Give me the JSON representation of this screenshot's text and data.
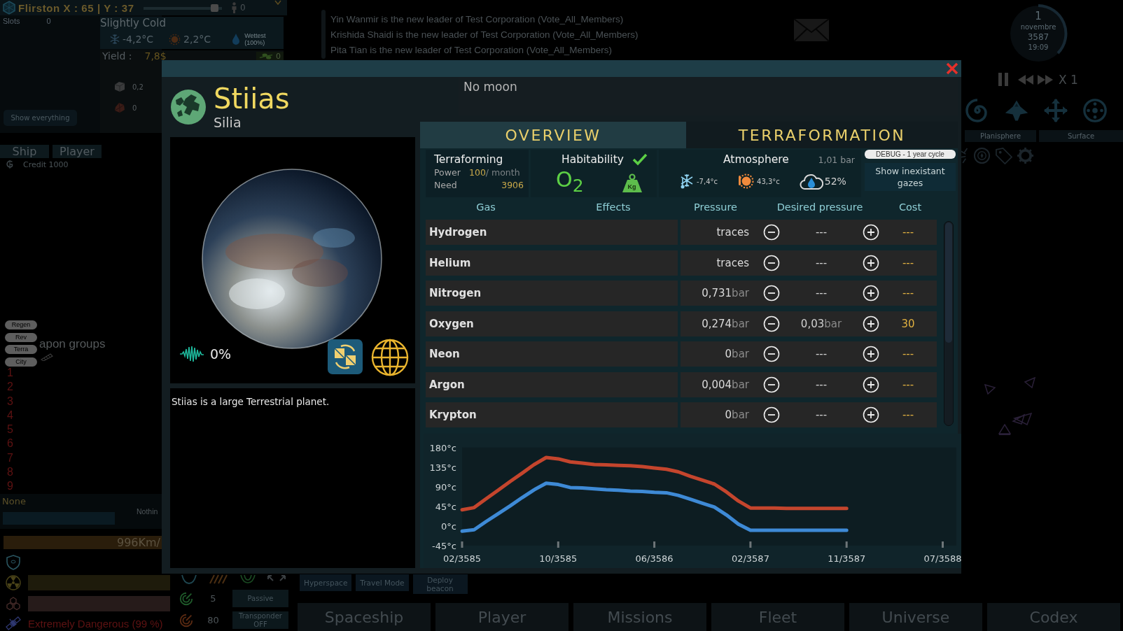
{
  "location_bar": {
    "title": "Flirston X : 65 | Y : 37",
    "slider": {
      "level": 0.95
    },
    "population": "0"
  },
  "slots": {
    "label": "Slots",
    "value": "0"
  },
  "weather": {
    "title": "Slightly Cold",
    "min_temp": "-4,2°C",
    "max_temp": "2,2°C",
    "humidity_label": "Wettest",
    "humidity_value": "(100%)"
  },
  "yield": {
    "label": "Yield :",
    "value": "7,8$",
    "food": "0",
    "resources": [
      {
        "kind": "stone",
        "amount": "0,2"
      },
      {
        "kind": "ore",
        "amount": "0"
      }
    ]
  },
  "show_everything_button": "Show everything",
  "panel_tabs": [
    {
      "label": "Ship",
      "selected": false
    },
    {
      "label": "Player",
      "selected": false
    }
  ],
  "credit": "Credit 1000",
  "module_tags": [
    "Regen",
    "Rev",
    "Terra",
    "City"
  ],
  "weapon_groups": {
    "title": "apon groups",
    "slots": [
      "1",
      "2",
      "3",
      "4",
      "5",
      "6",
      "7",
      "8",
      "9"
    ]
  },
  "target": {
    "name": "None",
    "status": "Nothin"
  },
  "speed": "996Km/",
  "danger": "Extremely Dangerous (99 %)",
  "sensors": [
    {
      "kind": "radar",
      "value": "5",
      "mode": "Passive"
    },
    {
      "kind": "transponder",
      "value": "80",
      "mode": "Transponder OFF"
    }
  ],
  "travel_buttons": [
    "Hyperspace",
    "Travel Mode",
    "Deploy beacon"
  ],
  "messages": [
    "Yin Wanmir is the new leader of Test Corporation (Vote_All_Members)",
    "Krishida Shaidi is the new leader of Test Corporation (Vote_All_Members)",
    "Pita Tian is the new leader of Test Corporation (Vote_All_Members)"
  ],
  "clock": {
    "day": "1",
    "month": "novembre",
    "year": "3587",
    "time": "19:09"
  },
  "time_speed": "X 1",
  "view_tabs": [
    "Planisphere",
    "Surface"
  ],
  "main_tabs": [
    {
      "label": "Spaceship",
      "selected": false
    },
    {
      "label": "Player",
      "selected": false
    },
    {
      "label": "Missions",
      "selected": false
    },
    {
      "label": "Fleet",
      "selected": false
    },
    {
      "label": "Universe",
      "selected": false
    },
    {
      "label": "Codex",
      "selected": false
    }
  ],
  "planet_window": {
    "name": "Stiias",
    "system": "Silia",
    "moon": "No moon",
    "life": "0%",
    "description": "Stiias is a large Terrestrial planet.",
    "tabs": [
      {
        "label": "OVERVIEW",
        "selected": true
      },
      {
        "label": "TERRAFORMATION",
        "selected": false
      }
    ],
    "terraforming": {
      "title": "Terraforming",
      "power_label": "Power",
      "power": "100",
      "power_unit": "/ month",
      "need_label": "Need",
      "need": "3906"
    },
    "habitability": {
      "title": "Habitability",
      "habitable": true,
      "oxygen": "O$_{2}$",
      "gravity": "Kg"
    },
    "atmosphere": {
      "title": "Atmosphere",
      "pressure": "1,01 bar",
      "min_temp": "-7,4°c",
      "max_temp": "43,3°c",
      "humidity": "52%"
    },
    "debug_label": "DEBUG - 1 year cycle",
    "show_gases_button": "Show inexistant gazes",
    "columns": [
      "Gas",
      "Effects",
      "Pressure",
      "Desired pressure",
      "Cost"
    ],
    "gases": [
      {
        "name": "Hydrogen",
        "pressure": "traces",
        "desired": "---",
        "cost": "---"
      },
      {
        "name": "Helium",
        "pressure": "traces",
        "desired": "---",
        "cost": "---"
      },
      {
        "name": "Nitrogen",
        "pressure": "0,731",
        "pressure_unit": "bar",
        "desired": "---",
        "cost": "---"
      },
      {
        "name": "Oxygen",
        "pressure": "0,274",
        "pressure_unit": "bar",
        "desired": "0,03",
        "desired_unit": "bar",
        "cost": "30"
      },
      {
        "name": "Neon",
        "pressure": "0",
        "pressure_unit": "bar",
        "desired": "---",
        "cost": "---"
      },
      {
        "name": "Argon",
        "pressure": "0,004",
        "pressure_unit": "bar",
        "desired": "---",
        "cost": "---"
      },
      {
        "name": "Krypton",
        "pressure": "0",
        "pressure_unit": "bar",
        "desired": "---",
        "cost": "---"
      }
    ],
    "chart_data": {
      "type": "line",
      "categories": [
        "02/3585",
        null,
        null,
        null,
        null,
        null,
        null,
        null,
        "10/3585",
        null,
        null,
        null,
        null,
        null,
        null,
        null,
        "06/3586",
        null,
        null,
        null,
        null,
        null,
        null,
        null,
        "02/3587",
        null,
        null,
        null,
        null,
        null,
        null,
        null,
        "11/3587",
        null,
        null,
        null,
        null,
        null,
        null,
        null,
        "07/3588"
      ],
      "series": [
        {
          "color": "#c4452d",
          "values": [
            37,
            42,
            62,
            82,
            102,
            121,
            141,
            157,
            154,
            147,
            144,
            141,
            140,
            139,
            138,
            136,
            133,
            130,
            124,
            114,
            105,
            96,
            78,
            57,
            41,
            41,
            41,
            40,
            40,
            40,
            40,
            40,
            40,
            null,
            null,
            null,
            null,
            null,
            null,
            null,
            null
          ]
        },
        {
          "color": "#3e8ad6",
          "values": [
            -12,
            -9,
            10,
            28,
            46,
            65,
            83,
            98,
            95,
            88,
            87,
            85,
            83,
            82,
            80,
            79,
            77,
            76,
            70,
            61,
            52,
            43,
            25,
            4,
            -10,
            -10,
            -10,
            -10,
            -10,
            -10,
            -10,
            -10,
            -10,
            null,
            null,
            null,
            null,
            null,
            null,
            null,
            null
          ]
        }
      ],
      "ylim": [
        -45,
        180
      ],
      "yticks": [
        {
          "value": 180,
          "label": "180°c"
        },
        {
          "value": 135,
          "label": "135°c"
        },
        {
          "value": 90,
          "label": "90°c"
        },
        {
          "value": 45,
          "label": "45°c"
        },
        {
          "value": 0,
          "label": "0°c"
        },
        {
          "value": -45,
          "label": "-45°c"
        }
      ]
    }
  }
}
